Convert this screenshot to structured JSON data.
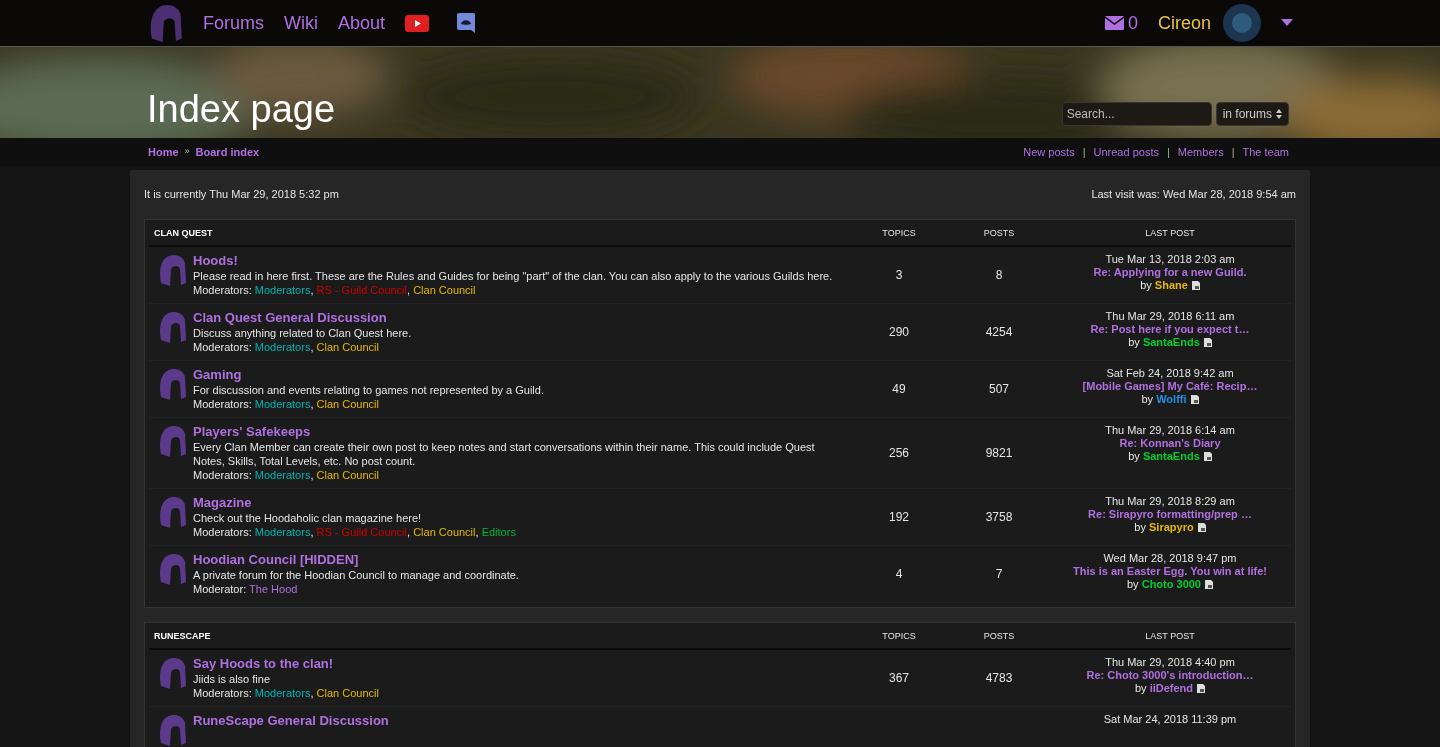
{
  "nav": {
    "links": [
      "Forums",
      "Wiki",
      "About"
    ],
    "messages_count": "0",
    "username": "Cireon"
  },
  "banner": {
    "title": "Index page",
    "search": {
      "placeholder": "Search..."
    },
    "scope": "in forums"
  },
  "breadcrumbs": {
    "items": [
      "Home",
      "Board index"
    ],
    "separator": "»"
  },
  "quick_links": {
    "items": [
      "New posts",
      "Unread posts",
      "Members",
      "The team"
    ],
    "separator": "|"
  },
  "status": {
    "current_time": "It is currently Thu Mar 29, 2018 5:32 pm",
    "last_visit": "Last visit was: Wed Mar 28, 2018 9:54 am"
  },
  "moderator_separator": ",",
  "sections": [
    {
      "title": "CLAN QUEST",
      "columns": [
        "TOPICS",
        "POSTS",
        "LAST POST"
      ],
      "forums": [
        {
          "title": "Hoods!",
          "description": "Please read in here first. These are the Rules and Guides for being \"part\" of the clan. You can also apply to the various Guilds here.",
          "moderators_label": "Moderators:",
          "moderators": [
            {
              "name": "Moderators",
              "color": "#00b3b3"
            },
            {
              "name": "RS - Guild Council",
              "color": "#cc0000"
            },
            {
              "name": "Clan Council",
              "color": "#e6b800"
            }
          ],
          "topics": "3",
          "posts": "8",
          "last_post": {
            "date": "Tue Mar 13, 2018 2:03 am",
            "subject": "Re: Applying for a new Guild.",
            "by_label": "by",
            "author": {
              "name": "Shane",
              "color": "#e6b800"
            }
          }
        },
        {
          "title": "Clan Quest General Discussion",
          "description": "Discuss anything related to Clan Quest here.",
          "moderators_label": "Moderators:",
          "moderators": [
            {
              "name": "Moderators",
              "color": "#00b3b3"
            },
            {
              "name": "Clan Council",
              "color": "#e6b800"
            }
          ],
          "topics": "290",
          "posts": "4254",
          "last_post": {
            "date": "Thu Mar 29, 2018 6:11 am",
            "subject": "Re: Post here if you expect t…",
            "by_label": "by",
            "author": {
              "name": "SantaEnds",
              "color": "#00cc33"
            }
          }
        },
        {
          "title": "Gaming",
          "description": "For discussion and events relating to games not represented by a Guild.",
          "moderators_label": "Moderators:",
          "moderators": [
            {
              "name": "Moderators",
              "color": "#00b3b3"
            },
            {
              "name": "Clan Council",
              "color": "#e6b800"
            }
          ],
          "topics": "49",
          "posts": "507",
          "last_post": {
            "date": "Sat Feb 24, 2018 9:42 am",
            "subject": "[Mobile Games] My Café: Recip…",
            "by_label": "by",
            "author": {
              "name": "Wolffi",
              "color": "#1e90e6"
            }
          }
        },
        {
          "title": "Players' Safekeeps",
          "description": "Every Clan Member can create their own post to keep notes and start conversations within their name. This could include Quest Notes, Skills, Total Levels, etc. No post count.",
          "moderators_label": "Moderators:",
          "moderators": [
            {
              "name": "Moderators",
              "color": "#00b3b3"
            },
            {
              "name": "Clan Council",
              "color": "#e6b800"
            }
          ],
          "topics": "256",
          "posts": "9821",
          "last_post": {
            "date": "Thu Mar 29, 2018 6:14 am",
            "subject": "Re: Konnan's Diary",
            "by_label": "by",
            "author": {
              "name": "SantaEnds",
              "color": "#00cc33"
            }
          }
        },
        {
          "title": "Magazine",
          "description": "Check out the Hoodaholic clan magazine here!",
          "moderators_label": "Moderators:",
          "moderators": [
            {
              "name": "Moderators",
              "color": "#00b3b3"
            },
            {
              "name": "RS - Guild Council",
              "color": "#cc0000"
            },
            {
              "name": "Clan Council",
              "color": "#e6b800"
            },
            {
              "name": "Editors",
              "color": "#00b33c"
            }
          ],
          "topics": "192",
          "posts": "3758",
          "last_post": {
            "date": "Thu Mar 29, 2018 8:29 am",
            "subject": "Re: Sirapyro formatting/prep …",
            "by_label": "by",
            "author": {
              "name": "Sirapyro",
              "color": "#e6b800"
            }
          }
        },
        {
          "title": "Hoodian Council [HIDDEN]",
          "description": "A private forum for the Hoodian Council to manage and coordinate.",
          "moderators_label": "Moderator:",
          "moderators": [
            {
              "name": "The Hood",
              "color": "#b070e0"
            }
          ],
          "topics": "4",
          "posts": "7",
          "last_post": {
            "date": "Wed Mar 28, 2018 9:47 pm",
            "subject": "This is an Easter Egg. You win at life!",
            "by_label": "by",
            "author": {
              "name": "Choto 3000",
              "color": "#00cc33"
            }
          }
        }
      ]
    },
    {
      "title": "RUNESCAPE",
      "columns": [
        "TOPICS",
        "POSTS",
        "LAST POST"
      ],
      "forums": [
        {
          "title": "Say Hoods to the clan!",
          "description": "Jiids is also fine",
          "moderators_label": "Moderators:",
          "moderators": [
            {
              "name": "Moderators",
              "color": "#00b3b3"
            },
            {
              "name": "Clan Council",
              "color": "#e6b800"
            }
          ],
          "topics": "367",
          "posts": "4783",
          "last_post": {
            "date": "Thu Mar 29, 2018 4:40 pm",
            "subject": "Re: Choto 3000's introduction…",
            "by_label": "by",
            "author": {
              "name": "iiDefend",
              "color": "#b070e0"
            }
          }
        },
        {
          "title": "RuneScape General Discussion",
          "last_post": {
            "date": "Sat Mar 24, 2018 11:39 pm"
          }
        }
      ]
    }
  ]
}
